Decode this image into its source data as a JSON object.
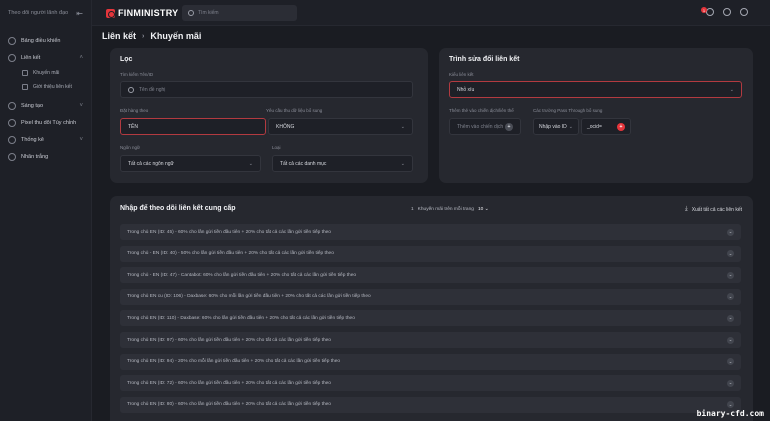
{
  "sidebar": {
    "header": "Theo dõi người lãnh đạo",
    "items": [
      {
        "label": "Bảng điều khiển"
      },
      {
        "label": "Liên kết"
      },
      {
        "label": "Sáng tạo"
      },
      {
        "label": "Pixel thu dõi Tùy chỉnh"
      },
      {
        "label": "Thống kê"
      },
      {
        "label": "Nhãn trắng"
      }
    ],
    "subitems": [
      {
        "label": "Khuyến mãi"
      },
      {
        "label": "Giới thiệu liên kết"
      }
    ]
  },
  "topbar": {
    "brand": "FINMINISTRY",
    "search_placeholder": "Tìm kiếm",
    "notif_count": "1"
  },
  "breadcrumb": {
    "root": "Liên kết",
    "sep": "›",
    "current": "Khuyến mãi"
  },
  "filter": {
    "title": "Lọc",
    "search_label": "Tìm kiếm Tên/ID",
    "search_placeholder": "Tên đề nghị",
    "sort_label": "Đặt hàng theo",
    "sort_value": "TÊN",
    "extra_label": "Yêu cầu thu dữ liệu bổ sung",
    "extra_value": "KHÔNG",
    "lang_label": "Ngôn ngữ",
    "lang_value": "Tất cả các ngôn ngữ",
    "type_label": "Loại",
    "type_value": "Tất cả các danh mục"
  },
  "editor": {
    "title": "Trình sửa đổi liên kết",
    "type_label": "Kiểu liên kết",
    "type_value": "Nhỏ xíu",
    "campaign_label": "Thêm thẻ vào chiến dịch/liên thể",
    "campaign_placeholder": "Thêm vào chiến dịch",
    "param_label": "Các trường Pass Through bổ sung",
    "param_select": "Nhập vào ID",
    "param_value": "_ocid="
  },
  "offers": {
    "title": "Nhập để theo dõi liên kết cung cấp",
    "count_text": "Khuyến mãi trên mỗi trang",
    "per_page": "10",
    "export": "Xuất tất cả các liên kết",
    "rows": [
      "Trong chủ EN (ID: 45) - 60% cho lần gửi tiền đầu tiên + 20% cho tất cả các lần gửi tiền tiếp theo",
      "Trong chủ - EN (ID: 40) - 50% cho lần gửi tiền đầu tiên + 20% cho tất cả các lần gửi tiền tiếp theo",
      "Trong chủ - EN (ID: 47) - Cantabot: 60% cho lần gửi tiền đầu tiên + 20% cho tất cả các lần gửi tiền tiếp theo",
      "Trong chủ EN cu (ID: 106) - Daxbase: 60% cho mỗi lần gửi tiền đầu tiên + 20% cho tất cả các lần gửi tiền tiếp theo",
      "Trong chủ EN (ID: 110) - Daxbase: 60% cho lần gửi tiền đầu tiên + 20% cho tất cả các lần gửi tiền tiếp theo",
      "Trong chủ EN (ID: 97) - 60% cho lần gửi tiền đầu tiên + 20% cho tất cả các lần gửi tiền tiếp theo",
      "Trong chủ EN (ID: 94) - 20% cho mỗi lần gửi tiền đầu tiên + 20% cho tất cả các lần gửi tiền tiếp theo",
      "Trong chủ EN (ID: 72) - 60% cho lần gửi tiền đầu tiên + 20% cho tất cả các lần gửi tiền tiếp theo",
      "Trong chủ EN (ID: 80) - 60% cho lần gửi tiền đầu tiên + 20% cho tất cả các lần gửi tiền tiếp theo"
    ]
  },
  "watermark": "binary-cfd.com",
  "colors": {
    "accent": "#e5353b",
    "bg": "#1a1c22",
    "card": "#26282f"
  }
}
